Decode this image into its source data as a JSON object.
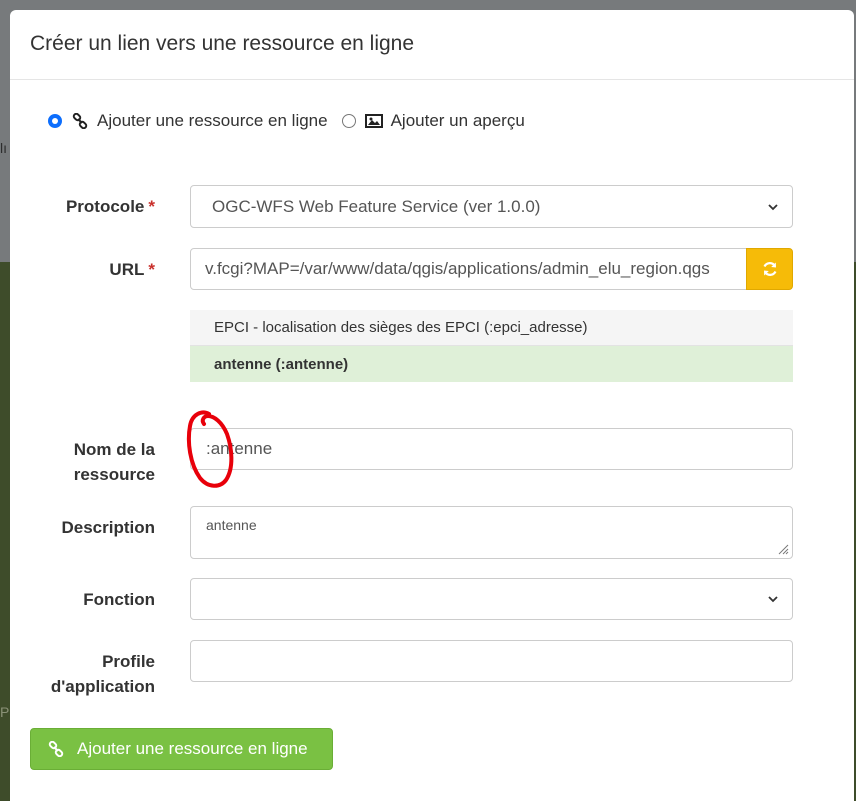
{
  "background": {
    "fragment_top": "lı",
    "fragment_bottom": "Po"
  },
  "modal": {
    "title": "Créer un lien vers une ressource en ligne"
  },
  "mode": {
    "options": [
      {
        "label": "Ajouter une ressource en ligne",
        "icon": "link-icon",
        "checked": true
      },
      {
        "label": "Ajouter un aperçu",
        "icon": "image-icon",
        "checked": false
      }
    ]
  },
  "form": {
    "protocol": {
      "label": "Protocole",
      "required_mark": "*",
      "value": "OGC-WFS Web Feature Service (ver 1.0.0)"
    },
    "url": {
      "label": "URL",
      "required_mark": "*",
      "value": "v.fcgi?MAP=/var/www/data/qgis/applications/admin_elu_region.qgs"
    },
    "layers": [
      {
        "label": "EPCI - localisation des sièges des EPCI (:epci_adresse)",
        "selected": false
      },
      {
        "label": "antenne (:antenne)",
        "selected": true
      }
    ],
    "name": {
      "label_line1": "Nom de la",
      "label_line2": "ressource",
      "value": ":antenne"
    },
    "description": {
      "label": "Description",
      "value": "antenne"
    },
    "function": {
      "label": "Fonction",
      "value": ""
    },
    "profile": {
      "label_line1": "Profile",
      "label_line2": "d'application",
      "value": ""
    }
  },
  "submit_label": "Ajouter une ressource en ligne",
  "colors": {
    "primary": "#0d6efd",
    "warning": "#f6bb08",
    "success": "#7ac143",
    "selected_row": "#dff0d8",
    "annotation": "#e8000a"
  }
}
